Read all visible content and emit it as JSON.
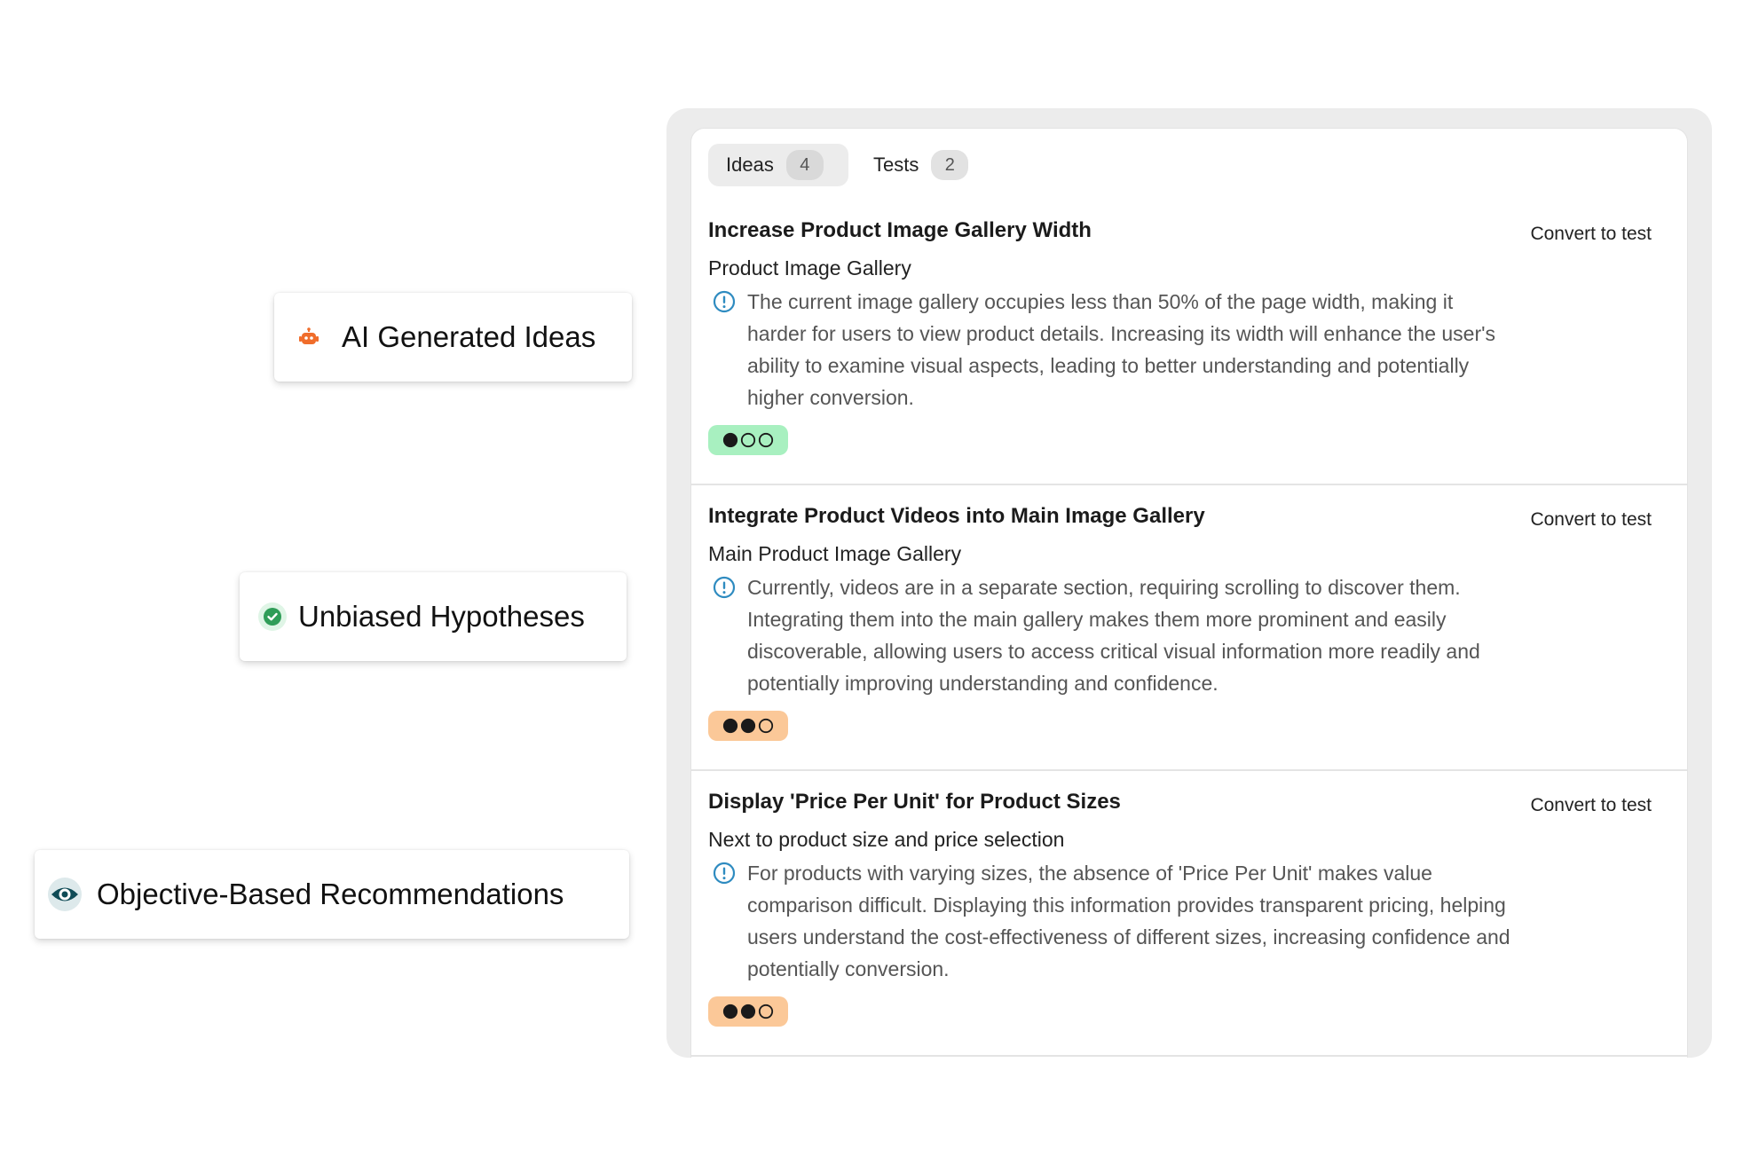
{
  "features": [
    {
      "label": "AI Generated Ideas",
      "icon": "robot-icon",
      "icon_color": "#f06d2b"
    },
    {
      "label": "Unbiased Hypotheses",
      "icon": "check-circle-icon",
      "icon_color": "#2f9d58"
    },
    {
      "label": "Objective-Based Recommendations",
      "icon": "eye-icon",
      "icon_color": "#0f4b56"
    }
  ],
  "tabs": [
    {
      "label": "Ideas",
      "count": "4",
      "active": true
    },
    {
      "label": "Tests",
      "count": "2",
      "active": false
    }
  ],
  "ideas": [
    {
      "title": "Increase Product Image Gallery Width",
      "area": "Product Image Gallery",
      "action": "Convert to test",
      "description": "The current image gallery occupies less than 50% of the page width, making it harder for users to view product details. Increasing its width will enhance the user's ability to examine visual aspects, leading to better understanding and potentially higher conversion.",
      "level": 1,
      "level_color": "#a8f0c0"
    },
    {
      "title": "Integrate Product Videos into Main Image Gallery",
      "area": "Main Product Image Gallery",
      "action": "Convert to test",
      "description": "Currently, videos are in a separate section, requiring scrolling to discover them. Integrating them into the main gallery makes them more prominent and easily discoverable, allowing users to access critical visual information more readily and potentially improving understanding and confidence.",
      "level": 2,
      "level_color": "#fbc898"
    },
    {
      "title": "Display 'Price Per Unit' for Product Sizes",
      "area": "Next to product size and price selection",
      "action": "Convert to test",
      "description": "For products with varying sizes, the absence of 'Price Per Unit' makes value comparison difficult. Displaying this information provides transparent pricing, helping users understand the cost-effectiveness of different sizes, increasing confidence and potentially conversion.",
      "level": 2,
      "level_color": "#fbc898"
    }
  ],
  "colors": {
    "info_icon": "#2e8bc0",
    "dot_filled": "#1a1a1a"
  }
}
